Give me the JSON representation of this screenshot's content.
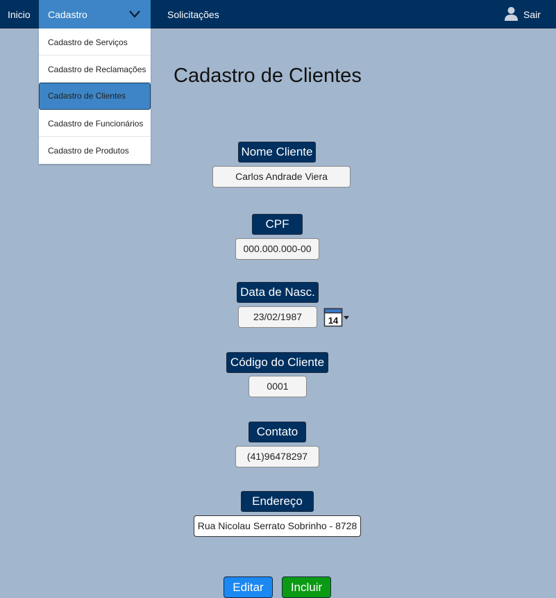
{
  "navbar": {
    "inicio": "Inicio",
    "cadastro": "Cadastro",
    "solicitacoes": "Solicitações",
    "sair": "Sair",
    "colors": {
      "bar": "#00305f",
      "active": "#3d85c6"
    }
  },
  "dropdown": {
    "items": [
      {
        "label": "Cadastro de Serviços"
      },
      {
        "label": "Cadastro de Reclamações"
      },
      {
        "label": "Cadastro de Clientes",
        "active": true
      },
      {
        "label": "Cadastro de Funcionários"
      },
      {
        "label": "Cadastro de Produtos"
      }
    ]
  },
  "page": {
    "title": "Cadastro de Clientes"
  },
  "form": {
    "nome": {
      "label": "Nome Cliente",
      "value": "Carlos Andrade Viera"
    },
    "cpf": {
      "label": "CPF",
      "value": "000.000.000-00"
    },
    "nascimento": {
      "label": "Data de Nasc.",
      "value": "23/02/1987",
      "calendar_day": "14"
    },
    "codigo": {
      "label": "Código do Cliente",
      "value": "0001"
    },
    "contato": {
      "label": "Contato",
      "value": "(41)96478297"
    },
    "endereco": {
      "label": "Endereço",
      "value": "Rua Nicolau Serrato Sobrinho - 8728"
    }
  },
  "actions": {
    "editar": "Editar",
    "incluir": "Incluir",
    "colors": {
      "editar": "#1c88f2",
      "incluir": "#0b9a14"
    }
  },
  "icons": [
    "chevron-down-icon",
    "user-icon",
    "calendar-icon"
  ]
}
